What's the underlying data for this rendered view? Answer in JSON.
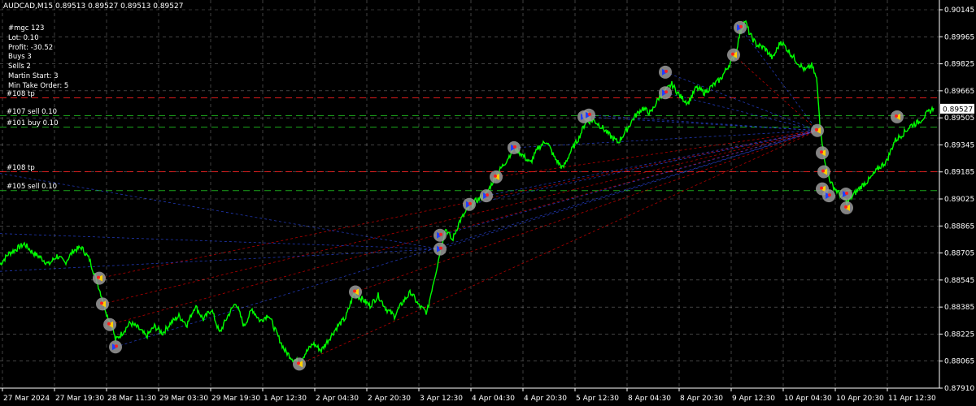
{
  "window": {
    "symbol": "AUDCAD,M15",
    "ohlc": "0.89513 0.89527 0.89513 0.89527"
  },
  "info_panel": {
    "lines": [
      "#mgc 123",
      "Lot: 0.10",
      "Profit: -30.52",
      "Buys 3",
      "Sells 2",
      "Martin Start: 3",
      "Min Take Order: 5"
    ]
  },
  "level_labels": [
    {
      "id": "tp1",
      "text": "#108 tp",
      "color": "#ff2020",
      "style": "dash",
      "price": 0.8959
    },
    {
      "id": "sell107",
      "text": "#107 sell 0.10",
      "color": "#20c020",
      "style": "dash",
      "price": 0.89486
    },
    {
      "id": "buy101",
      "text": "#101 buy 0.10",
      "color": "#20c020",
      "style": "dash",
      "price": 0.8942
    },
    {
      "id": "tp2",
      "text": "#108 tp",
      "color": "#ff2020",
      "style": "dash",
      "price": 0.8916
    },
    {
      "id": "sell105",
      "text": "#105 sell 0.10",
      "color": "#20c020",
      "style": "dash",
      "price": 0.8905
    }
  ],
  "colors": {
    "background": "#000000",
    "price_line": "#00ff00",
    "grid": "#c0c0c0",
    "sell_trade_line": "#ff0000",
    "buy_trade_line": "#3050ff",
    "current_price_box_bg": "#ffffff",
    "current_price_box_text": "#000000"
  },
  "chart_data": {
    "type": "line",
    "title": "AUDCAD,M15",
    "y_ticks": [
      "0.90145",
      "0.89965",
      "0.89825",
      "0.89665",
      "0.89505",
      "0.89345",
      "0.89185",
      "0.89025",
      "0.88865",
      "0.88705",
      "0.88545",
      "0.88385",
      "0.88225",
      "0.88065",
      "0.87910"
    ],
    "ylim": [
      0.879,
      0.9016
    ],
    "current_price": "0.89527",
    "x_ticks": [
      "27 Mar 2024",
      "27 Mar 19:30",
      "28 Mar 11:30",
      "29 Mar 03:30",
      "29 Mar 19:30",
      "1 Apr 12:30",
      "2 Apr 04:30",
      "2 Apr 20:30",
      "3 Apr 12:30",
      "4 Apr 04:30",
      "4 Apr 20:30",
      "5 Apr 12:30",
      "8 Apr 04:30",
      "8 Apr 20:30",
      "9 Apr 12:30",
      "10 Apr 04:30",
      "10 Apr 20:30",
      "11 Apr 12:30"
    ],
    "grid": true,
    "series": [
      {
        "values": [
          [
            0,
            0.8862
          ],
          [
            10,
            0.8868
          ],
          [
            20,
            0.8871
          ],
          [
            30,
            0.8874
          ],
          [
            40,
            0.8869
          ],
          [
            50,
            0.8866
          ],
          [
            60,
            0.8862
          ],
          [
            70,
            0.8867
          ],
          [
            80,
            0.8863
          ],
          [
            90,
            0.887
          ],
          [
            100,
            0.8872
          ],
          [
            110,
            0.8865
          ],
          [
            120,
            0.8851
          ],
          [
            126,
            0.8842
          ],
          [
            132,
            0.8832
          ],
          [
            138,
            0.8826
          ],
          [
            142,
            0.8818
          ],
          [
            150,
            0.8822
          ],
          [
            160,
            0.8828
          ],
          [
            170,
            0.8825
          ],
          [
            180,
            0.882
          ],
          [
            190,
            0.8826
          ],
          [
            200,
            0.8822
          ],
          [
            210,
            0.8828
          ],
          [
            220,
            0.8832
          ],
          [
            230,
            0.8827
          ],
          [
            240,
            0.8838
          ],
          [
            250,
            0.883
          ],
          [
            260,
            0.8836
          ],
          [
            270,
            0.8822
          ],
          [
            280,
            0.8832
          ],
          [
            290,
            0.884
          ],
          [
            300,
            0.8826
          ],
          [
            310,
            0.8836
          ],
          [
            320,
            0.8829
          ],
          [
            330,
            0.8833
          ],
          [
            340,
            0.8822
          ],
          [
            350,
            0.8812
          ],
          [
            360,
            0.8807
          ],
          [
            368,
            0.8805
          ],
          [
            375,
            0.881
          ],
          [
            385,
            0.8816
          ],
          [
            395,
            0.8812
          ],
          [
            405,
            0.8819
          ],
          [
            415,
            0.8826
          ],
          [
            425,
            0.8831
          ],
          [
            435,
            0.8845
          ],
          [
            445,
            0.8842
          ],
          [
            455,
            0.8838
          ],
          [
            465,
            0.8844
          ],
          [
            475,
            0.8836
          ],
          [
            485,
            0.8832
          ],
          [
            495,
            0.884
          ],
          [
            505,
            0.8846
          ],
          [
            515,
            0.8838
          ],
          [
            525,
            0.8834
          ],
          [
            532,
            0.885
          ],
          [
            538,
            0.8862
          ],
          [
            542,
            0.8872
          ],
          [
            548,
            0.8883
          ],
          [
            556,
            0.8876
          ],
          [
            565,
            0.8887
          ],
          [
            575,
            0.8894
          ],
          [
            585,
            0.8899
          ],
          [
            598,
            0.8903
          ],
          [
            610,
            0.8914
          ],
          [
            622,
            0.8922
          ],
          [
            632,
            0.893
          ],
          [
            642,
            0.8926
          ],
          [
            652,
            0.8921
          ],
          [
            662,
            0.893
          ],
          [
            672,
            0.8934
          ],
          [
            682,
            0.8924
          ],
          [
            692,
            0.8918
          ],
          [
            702,
            0.8928
          ],
          [
            712,
            0.8936
          ],
          [
            720,
            0.8945
          ],
          [
            730,
            0.8946
          ],
          [
            740,
            0.8942
          ],
          [
            750,
            0.8937
          ],
          [
            760,
            0.8933
          ],
          [
            770,
            0.894
          ],
          [
            780,
            0.8948
          ],
          [
            790,
            0.8953
          ],
          [
            800,
            0.895
          ],
          [
            810,
            0.8959
          ],
          [
            818,
            0.8963
          ],
          [
            826,
            0.8967
          ],
          [
            836,
            0.896
          ],
          [
            846,
            0.8956
          ],
          [
            856,
            0.8965
          ],
          [
            866,
            0.8962
          ],
          [
            876,
            0.8966
          ],
          [
            886,
            0.897
          ],
          [
            896,
            0.8978
          ],
          [
            904,
            0.8984
          ],
          [
            910,
            0.8997
          ],
          [
            916,
            0.9004
          ],
          [
            922,
            0.8996
          ],
          [
            930,
            0.899
          ],
          [
            940,
            0.8988
          ],
          [
            950,
            0.8982
          ],
          [
            960,
            0.8992
          ],
          [
            970,
            0.8986
          ],
          [
            980,
            0.898
          ],
          [
            990,
            0.8975
          ],
          [
            998,
            0.8978
          ],
          [
            1004,
            0.897
          ],
          [
            1008,
            0.8945
          ],
          [
            1012,
            0.8929
          ],
          [
            1016,
            0.8918
          ],
          [
            1022,
            0.8909
          ],
          [
            1032,
            0.8903
          ],
          [
            1042,
            0.8898
          ],
          [
            1050,
            0.8903
          ],
          [
            1060,
            0.8908
          ],
          [
            1070,
            0.8912
          ],
          [
            1080,
            0.8918
          ],
          [
            1090,
            0.8922
          ],
          [
            1100,
            0.8934
          ],
          [
            1110,
            0.8938
          ],
          [
            1120,
            0.8943
          ],
          [
            1130,
            0.8945
          ],
          [
            1140,
            0.895
          ],
          [
            1148,
            0.8953
          ]
        ]
      }
    ],
    "trade_markers": [
      {
        "x": 122,
        "price": 0.8854,
        "side": "sell"
      },
      {
        "x": 126,
        "price": 0.8839,
        "side": "sell"
      },
      {
        "x": 135,
        "price": 0.8827,
        "side": "sell"
      },
      {
        "x": 142,
        "price": 0.8814,
        "side": "buy"
      },
      {
        "x": 368,
        "price": 0.8804,
        "side": "sell"
      },
      {
        "x": 437,
        "price": 0.8846,
        "side": "sell"
      },
      {
        "x": 541,
        "price": 0.8879,
        "side": "buy"
      },
      {
        "x": 541,
        "price": 0.8871,
        "side": "buy"
      },
      {
        "x": 577,
        "price": 0.8897,
        "side": "buy"
      },
      {
        "x": 598,
        "price": 0.8902,
        "side": "buy"
      },
      {
        "x": 610,
        "price": 0.8913,
        "side": "sell"
      },
      {
        "x": 632,
        "price": 0.893,
        "side": "buy"
      },
      {
        "x": 718,
        "price": 0.8948,
        "side": "buy"
      },
      {
        "x": 724,
        "price": 0.8949,
        "side": "buy"
      },
      {
        "x": 818,
        "price": 0.8962,
        "side": "buy"
      },
      {
        "x": 818,
        "price": 0.8974,
        "side": "buy"
      },
      {
        "x": 902,
        "price": 0.8984,
        "side": "sell"
      },
      {
        "x": 910,
        "price": 0.9,
        "side": "buy"
      },
      {
        "x": 1005,
        "price": 0.894,
        "side": "sell"
      },
      {
        "x": 1011,
        "price": 0.8927,
        "side": "sell"
      },
      {
        "x": 1013,
        "price": 0.8916,
        "side": "sell"
      },
      {
        "x": 1011,
        "price": 0.8906,
        "side": "sell"
      },
      {
        "x": 1019,
        "price": 0.8902,
        "side": "buy"
      },
      {
        "x": 1040,
        "price": 0.8903,
        "side": "buy"
      },
      {
        "x": 1041,
        "price": 0.8895,
        "side": "sell"
      },
      {
        "x": 1103,
        "price": 0.8948,
        "side": "sell"
      }
    ]
  }
}
